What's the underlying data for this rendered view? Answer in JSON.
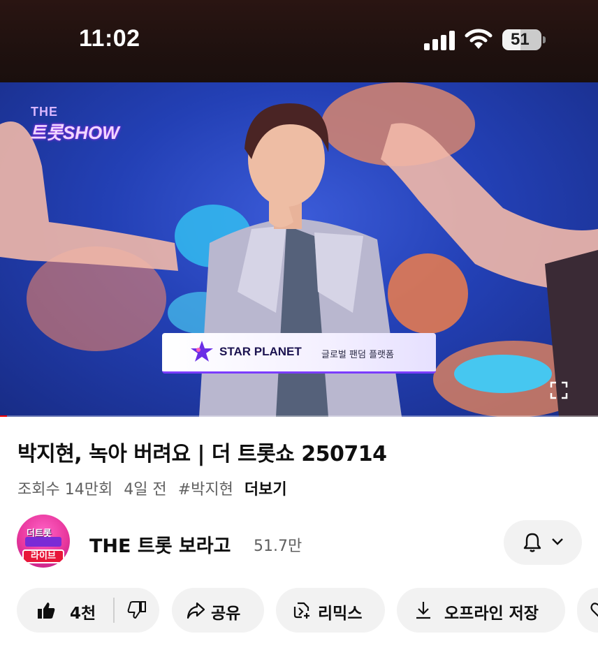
{
  "status_bar": {
    "time": "11:02",
    "battery": "51",
    "icons": [
      "signal-icon",
      "wifi-icon",
      "battery-icon"
    ]
  },
  "video": {
    "show_logo_top": "THE",
    "show_logo_main": "트롯SHOW",
    "banner_name": "STAR PLANET",
    "banner_tag": "글로벌 팬덤 플랫폼",
    "progress": 0.012,
    "colors": {
      "progress": "#ff0000",
      "accent_purple": "#7b3cff"
    }
  },
  "info": {
    "title": "박지현, 녹아 버려요 | 더 트롯쇼 250714",
    "views": "조회수 14만회",
    "age": "4일 전",
    "hashtag": "#박지현",
    "more": "더보기"
  },
  "channel": {
    "avatar_top": "더트롯",
    "avatar_badge": "라이브",
    "name": "THE 트롯 보라고",
    "subscribers": "51.7만"
  },
  "actions": {
    "like_count": "4천",
    "share": "공유",
    "remix": "리믹스",
    "offline": "오프라인 저장"
  }
}
